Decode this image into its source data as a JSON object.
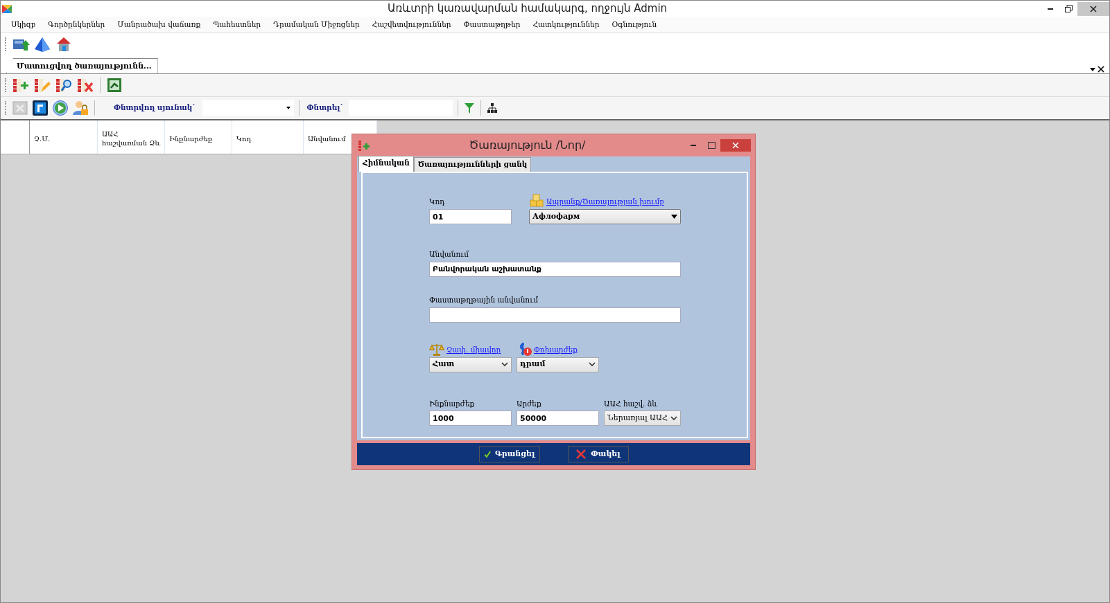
{
  "window": {
    "title": "Առևտրի կառավարման համակարգ, ողջույն Admin"
  },
  "menu": [
    "Սկիզբ",
    "Գործընկերներ",
    "Մանրածախ վաճառք",
    "Պահեստներ",
    "Դրամական Միջոցներ",
    "Հաշվետվություններ",
    "Փաստաթղթեր",
    "Հատկություններ",
    "Օգնություն"
  ],
  "document_tabs": [
    {
      "label": "Մատուցվող ծառայությունն...",
      "selected": true
    }
  ],
  "filter": {
    "column_label": "Փնտրվող սյունակ`",
    "search_label": "Փնտրել`"
  },
  "table": {
    "columns": [
      "Չ.Մ.",
      "ԱԱՀ հաշվառման Ձև",
      "Ինքնարժեք",
      "Կոդ",
      "Անվանում"
    ]
  },
  "dialog": {
    "title": "Ծառայություն /Նոր/",
    "tabs": [
      {
        "label": "Հիմնական",
        "selected": true
      },
      {
        "label": "Ծառայությունների ցանկ",
        "selected": false
      }
    ],
    "rows": [
      [
        {
          "kind": "input",
          "label": "Կոդ",
          "link": false,
          "value": "01"
        },
        {
          "kind": "combo",
          "label": "Ապրանք/Ծառայության խումբ",
          "link": true,
          "value": "Афлофарм"
        }
      ],
      [
        {
          "kind": "input",
          "label": "Անվանում",
          "link": false,
          "value": "Բանվորական աշխատանք"
        }
      ],
      [
        {
          "kind": "input",
          "label": "Փաստաթղթային անվանում",
          "link": false
        }
      ],
      [
        {
          "kind": "select",
          "label": "Չափ. միավոր",
          "link": true,
          "value": "Հատ"
        },
        {
          "kind": "select",
          "label": "Փոխարժեք",
          "link": true,
          "value": "դրամ"
        }
      ],
      [
        {
          "kind": "input",
          "label": "Ինքնարժեք",
          "link": false,
          "value": "1000"
        },
        {
          "kind": "input",
          "label": "Արժեք",
          "link": false,
          "value": "50000"
        },
        {
          "kind": "list",
          "label": "ԱԱՀ հաշվ. ձև",
          "link": false,
          "value": "Ներառյալ ԱԱՀ"
        }
      ]
    ],
    "buttons": [
      {
        "kind": "save",
        "label": "Գրանցել"
      },
      {
        "kind": "close",
        "label": "Փակել"
      }
    ]
  }
}
